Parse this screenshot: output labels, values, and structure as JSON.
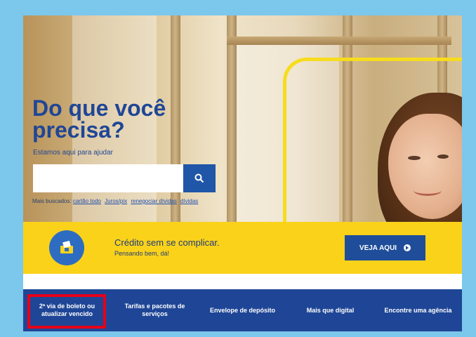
{
  "hero": {
    "headline": "Do que você precisa?",
    "subline": "Estamos aqui para ajudar",
    "search": {
      "value": "",
      "placeholder": ""
    },
    "popular": {
      "label": "Mais buscados:",
      "links": [
        "cartão todo",
        "Juros/pix",
        "renegociar dívidas",
        "dívidas"
      ]
    }
  },
  "promo": {
    "title": "Crédito sem se complicar.",
    "subtitle": "Pensando bem, dá!",
    "button_label": "VEJA AQUI"
  },
  "nav": {
    "items": [
      {
        "label": "2ª via de boleto ou atualizar vencido"
      },
      {
        "label": "Tarifas e pacotes de serviços"
      },
      {
        "label": "Envelope de depósito"
      },
      {
        "label": "Mais que digital"
      },
      {
        "label": "Encontre uma agência"
      }
    ]
  },
  "colors": {
    "brand_blue": "#1f4696",
    "brand_yellow": "#fad21a",
    "highlight_red": "#e60019"
  }
}
